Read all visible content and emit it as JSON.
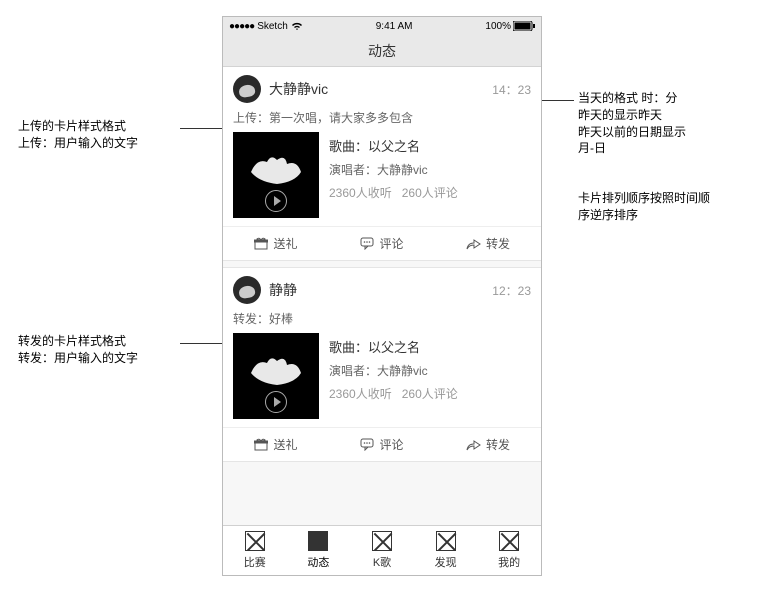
{
  "status": {
    "carrier": "Sketch",
    "time": "9:41 AM",
    "battery": "100%"
  },
  "nav": {
    "title": "动态"
  },
  "cards": [
    {
      "username": "大静静vic",
      "time": "14：23",
      "label": "上传：第一次唱，请大家多多包含",
      "song_title": "歌曲：以父之名",
      "artist": "演唱者：大静静vic",
      "stats_listen": "2360人收听",
      "stats_comment": "260人评论"
    },
    {
      "username": "静静",
      "time": "12：23",
      "label": "转发：好棒",
      "song_title": "歌曲：以父之名",
      "artist": "演唱者：大静静vic",
      "stats_listen": "2360人收听",
      "stats_comment": "260人评论"
    }
  ],
  "actions": {
    "gift": "送礼",
    "comment": "评论",
    "share": "转发"
  },
  "tabs": [
    "比赛",
    "动态",
    "K歌",
    "发现",
    "我的"
  ],
  "annotations": {
    "left1a": "上传的卡片样式格式",
    "left1b": "上传：用户输入的文字",
    "left2a": "转发的卡片样式格式",
    "left2b": "转发：用户输入的文字",
    "right1a": "当天的格式  时：分",
    "right1b": "昨天的显示昨天",
    "right1c": "昨天以前的日期显示",
    "right1d": "月-日",
    "right2a": "卡片排列顺序按照时间顺",
    "right2b": "序逆序排序"
  }
}
